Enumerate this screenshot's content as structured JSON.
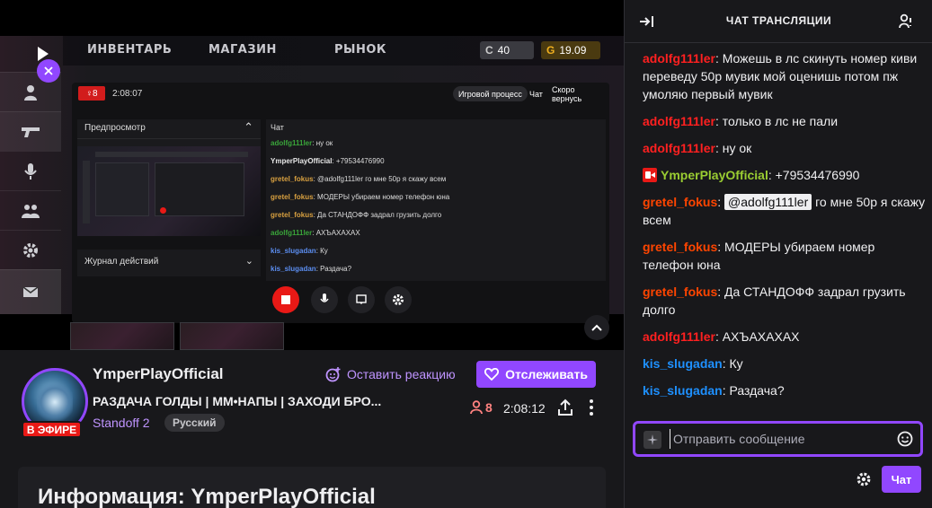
{
  "game": {
    "tabs": [
      "ИНВЕНТАРЬ",
      "МАГАЗИН",
      "РЫНОК"
    ],
    "silver": "40",
    "gold": "19.09",
    "record_viewers": "8",
    "record_time": "2:08:07",
    "buttons": [
      "Игровой процесс",
      "Чат",
      "Скоро вернусь"
    ],
    "preview_label": "Предпросмотр",
    "log_label": "Журнал действий",
    "chat_label": "Чат",
    "mini_chat": [
      {
        "user": "adolfg111ler",
        "text": ": ну ок",
        "color": "#3aa53a"
      },
      {
        "user": "YmperPlayOfficial",
        "text": ": +79534476990",
        "color": "#e8e8e8"
      },
      {
        "user": "gretel_fokus",
        "text": ": @adolfg111ler го мне 50р я скажу всем",
        "color": "#d8a040"
      },
      {
        "user": "gretel_fokus",
        "text": ": МОДЕРЫ убираем номер телефон юна",
        "color": "#d8a040"
      },
      {
        "user": "gretel_fokus",
        "text": ": Да СТАНДОФФ задрал грузить долго",
        "color": "#d8a040"
      },
      {
        "user": "adolfg111ler",
        "text": ": АХЪАХАХАХ",
        "color": "#3aa53a"
      },
      {
        "user": "kis_slugadan",
        "text": ": Ку",
        "color": "#5b8def"
      },
      {
        "user": "kis_slugadan",
        "text": ": Раздача?",
        "color": "#5b8def"
      }
    ]
  },
  "stream": {
    "channel": "YmperPlayOfficial",
    "title": "РАЗДАЧА ГОЛДЫ | ММ•НАПЫ | ЗАХОДИ БРО...",
    "category": "Standoff 2",
    "language": "Русский",
    "live_label": "В ЭФИРЕ",
    "react_label": "Оставить реакцию",
    "follow_label": "Отслеживать",
    "viewers": "8",
    "uptime": "2:08:12",
    "info_heading": "Информация: YmperPlayOfficial"
  },
  "chat": {
    "title": "ЧАТ ТРАНСЛЯЦИИ",
    "placeholder": "Отправить сообщение",
    "send_label": "Чат",
    "messages": [
      {
        "user": "adolfg111ler",
        "color": "#ff2020",
        "text": ": Можешь в лс скинуть номер киви переведу 50р мувик мой оценишь потом пж умоляю первый мувик"
      },
      {
        "user": "adolfg111ler",
        "color": "#ff2020",
        "text": ": только в лс не пали"
      },
      {
        "user": "adolfg111ler",
        "color": "#ff2020",
        "text": ": ну ок"
      },
      {
        "user": "YmperPlayOfficial",
        "color": "#9acd32",
        "text": ": +79534476990",
        "badge": "camera"
      },
      {
        "user": "gretel_fokus",
        "color": "#ff4500",
        "pre": ": ",
        "mention": "@adolfg111ler",
        "text": " го мне 50р я скажу всем"
      },
      {
        "user": "gretel_fokus",
        "color": "#ff4500",
        "text": ": МОДЕРЫ убираем номер телефон юна"
      },
      {
        "user": "gretel_fokus",
        "color": "#ff4500",
        "text": ": Да СТАНДОФФ задрал грузить долго"
      },
      {
        "user": "adolfg111ler",
        "color": "#ff2020",
        "text": ": АХЪАХАХАХ"
      },
      {
        "user": "kis_slugadan",
        "color": "#1e90ff",
        "text": ": Ку"
      },
      {
        "user": "kis_slugadan",
        "color": "#1e90ff",
        "text": ": Раздача?"
      }
    ]
  },
  "icons": [
    "play-icon",
    "close-icon",
    "person-icon",
    "gun-icon",
    "mic-icon",
    "group-icon",
    "gear-icon",
    "mail-icon",
    "stop-icon",
    "chat-icon",
    "heart-icon",
    "react-icon",
    "share-icon",
    "more-icon",
    "collapse-icon",
    "users-icon",
    "sparkle-icon",
    "emote-icon",
    "chevron-up-icon"
  ],
  "colors": {
    "accent": "#9147ff",
    "live": "#e91916",
    "mention_bg": "#efeff1"
  }
}
